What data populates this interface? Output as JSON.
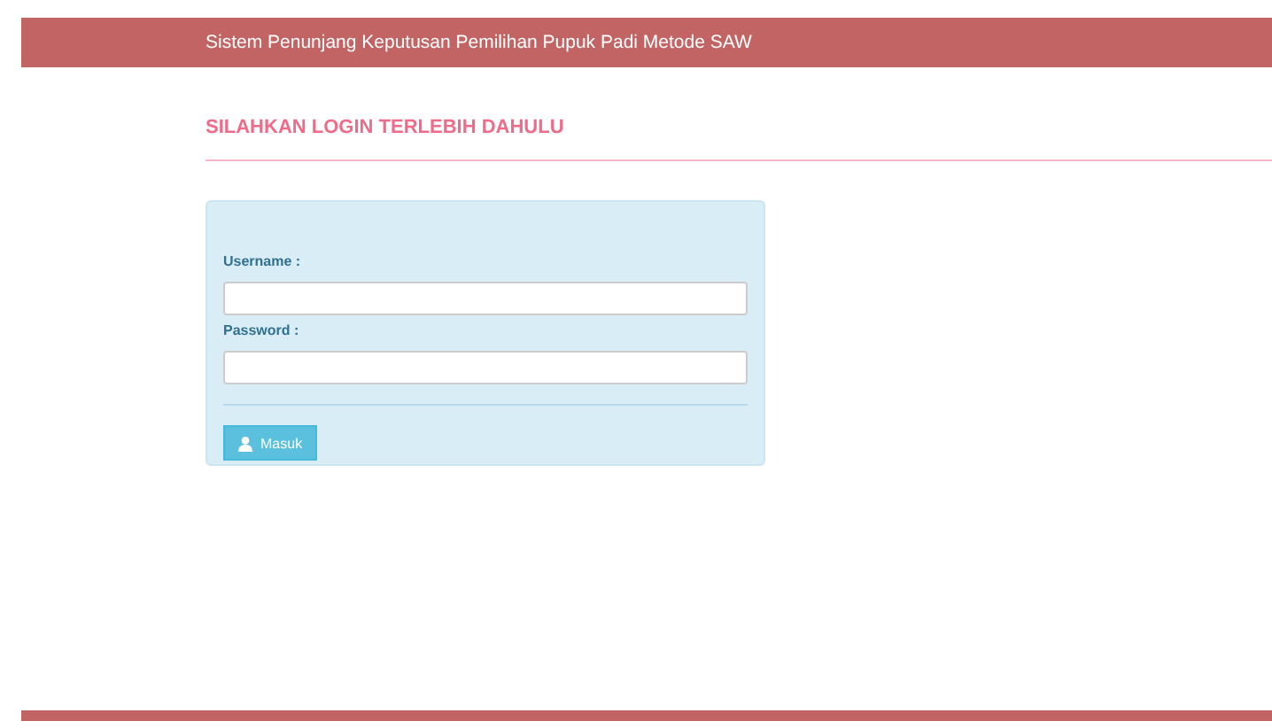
{
  "header": {
    "title": "Sistem Penunjang Keputusan Pemilihan Pupuk Padi Metode SAW"
  },
  "page": {
    "heading": "SILAHKAN LOGIN TERLEBIH DAHULU"
  },
  "form": {
    "fields": [
      {
        "label": "Username :"
      },
      {
        "label": "Password :"
      }
    ],
    "button": "Masuk"
  }
}
